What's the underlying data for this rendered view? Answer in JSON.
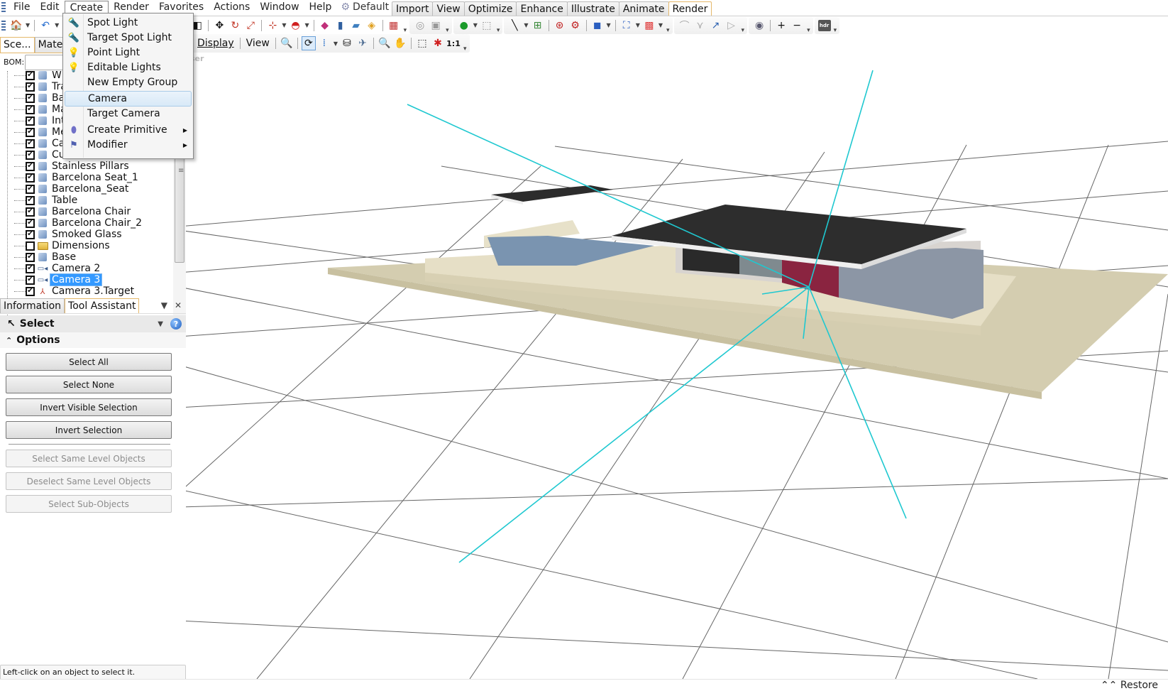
{
  "menubar": {
    "items": [
      "File",
      "Edit",
      "Create",
      "Render",
      "Favorites",
      "Actions",
      "Window",
      "Help"
    ],
    "workspace": "Default"
  },
  "ribbon_tabs": [
    "Import",
    "View",
    "Optimize",
    "Enhance",
    "Illustrate",
    "Animate",
    "Render"
  ],
  "active_ribbon_tab": "Render",
  "toolbar2": {
    "display_label": "Display",
    "view_label": "View",
    "actual_size_label": "1:1"
  },
  "create_menu": {
    "items": [
      {
        "label": "Spot Light",
        "icon": "spot-light-icon"
      },
      {
        "label": "Target Spot Light",
        "icon": "target-spot-light-icon"
      },
      {
        "label": "Point Light",
        "icon": "point-light-icon"
      },
      {
        "label": "Editable Lights",
        "icon": "editable-lights-icon"
      },
      {
        "label": "New Empty Group",
        "icon": ""
      },
      {
        "label": "Camera",
        "icon": "",
        "highlighted": true
      },
      {
        "label": "Target Camera",
        "icon": ""
      },
      {
        "label": "Create Primitive",
        "icon": "primitive-icon",
        "submenu": true
      },
      {
        "label": "Modifier",
        "icon": "modifier-icon",
        "submenu": true
      }
    ]
  },
  "left_panel": {
    "tabs": [
      "Sce...",
      "Mater"
    ],
    "bom_label": "BOM:",
    "bom_value": "",
    "scene_tree": [
      {
        "label": "W",
        "checked": true,
        "type": "object"
      },
      {
        "label": "Tra",
        "checked": true,
        "type": "object"
      },
      {
        "label": "Ba",
        "checked": true,
        "type": "object"
      },
      {
        "label": "Ma",
        "checked": true,
        "type": "object"
      },
      {
        "label": "Int",
        "checked": true,
        "type": "object"
      },
      {
        "label": "Me",
        "checked": true,
        "type": "object"
      },
      {
        "label": "Ca",
        "checked": true,
        "type": "object"
      },
      {
        "label": "Cu",
        "checked": true,
        "type": "object"
      },
      {
        "label": "Stainless Pillars",
        "checked": true,
        "type": "object"
      },
      {
        "label": "Barcelona Seat_1",
        "checked": true,
        "type": "object"
      },
      {
        "label": "Barcelona_Seat",
        "checked": true,
        "type": "object"
      },
      {
        "label": "Table",
        "checked": true,
        "type": "object"
      },
      {
        "label": "Barcelona Chair",
        "checked": true,
        "type": "object"
      },
      {
        "label": "Barcelona Chair_2",
        "checked": true,
        "type": "object"
      },
      {
        "label": "Smoked Glass",
        "checked": true,
        "type": "object"
      },
      {
        "label": "Dimensions",
        "checked": false,
        "type": "folder"
      },
      {
        "label": "Base",
        "checked": true,
        "type": "object"
      },
      {
        "label": "Camera 2",
        "checked": true,
        "type": "camera"
      },
      {
        "label": "Camera 3",
        "checked": true,
        "type": "camera",
        "selected": true
      },
      {
        "label": "Camera 3.Target",
        "checked": true,
        "type": "target"
      }
    ]
  },
  "tool_assistant": {
    "tabs": [
      "Information",
      "Tool Assistant"
    ],
    "active_tab": "Tool Assistant",
    "tool_name": "Select",
    "options_label": "Options",
    "buttons": [
      {
        "label": "Select All",
        "enabled": true
      },
      {
        "label": "Select None",
        "enabled": true
      },
      {
        "label": "Invert Visible Selection",
        "enabled": true
      },
      {
        "label": "Invert Selection",
        "enabled": true
      }
    ],
    "disabled_buttons": [
      {
        "label": "Select Same Level Objects",
        "enabled": false
      },
      {
        "label": "Deselect Same Level Objects",
        "enabled": false
      },
      {
        "label": "Select Sub-Objects",
        "enabled": false
      }
    ],
    "status_text": "Left-click on an object to select it."
  },
  "viewport": {
    "label": "ser",
    "camera_line_color": "#1fc8d0",
    "grid_color": "#666666"
  },
  "bottombar": {
    "restore_label": "Restore"
  }
}
